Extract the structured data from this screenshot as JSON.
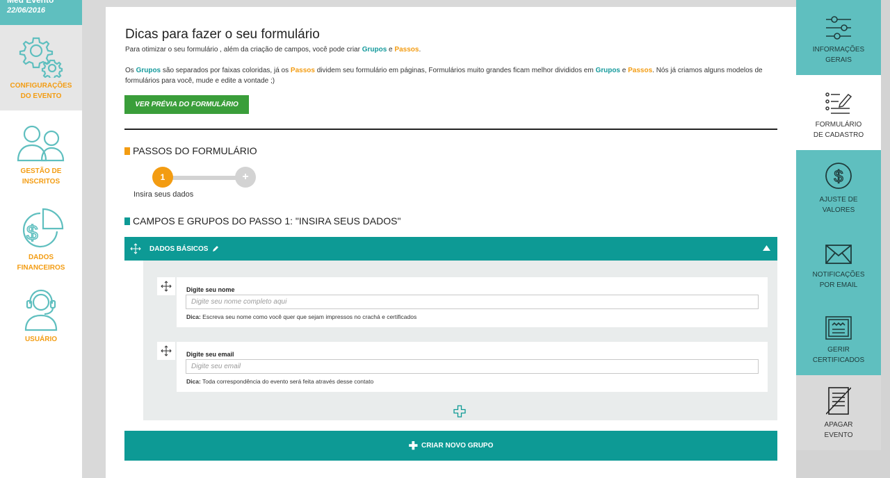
{
  "event": {
    "name": "Meu Evento",
    "date": "22/06/2016"
  },
  "left_nav": [
    {
      "label_lines": [
        "CONFIGURAÇÕES",
        "DO EVENTO"
      ],
      "icon": "gears-icon",
      "active": true
    },
    {
      "label_lines": [
        "GESTÃO DE",
        "INSCRITOS"
      ],
      "icon": "users-icon",
      "active": false
    },
    {
      "label_lines": [
        "DADOS",
        "FINANCEIROS"
      ],
      "icon": "dollar-chart-icon",
      "active": false
    },
    {
      "label_lines": [
        "USUÁRIO"
      ],
      "icon": "headset-user-icon",
      "active": false
    }
  ],
  "tips": {
    "title": "Dicas para fazer o seu formulário",
    "intro_prefix": "Para otimizar o seu formulário , além da criação de campos, você pode criar ",
    "groups_word": "Grupos",
    "and_word": " e ",
    "steps_word": "Passos",
    "intro_suffix": ".",
    "para_1": "Os ",
    "para_2": " são separados por faixas coloridas, já os ",
    "para_3": " dividem seu formulário em páginas, Formulários muito grandes ficam melhor divididos em ",
    "para_4": " e ",
    "para_5": ". Nós já criamos alguns modelos de formulários para você, mude e edite a vontade ;)"
  },
  "preview_button": "VER PRÉVIA DO FORMULÁRIO",
  "steps_section": {
    "title": "PASSOS DO FORMULÁRIO",
    "steps": [
      {
        "number": "1",
        "label": "Insira seus dados"
      }
    ],
    "add_symbol": "+"
  },
  "fields_section": {
    "title": "CAMPOS E GRUPOS DO PASSO 1: \"INSIRA SEUS DADOS\"",
    "group": {
      "title": "DADOS BÁSICOS",
      "fields": [
        {
          "label": "Digite seu nome",
          "placeholder": "Digite seu nome completo aqui",
          "tip_prefix": "Dica:",
          "tip": " Escreva seu nome como você quer que sejam impressos no crachá e certificados"
        },
        {
          "label": "Digite seu email",
          "placeholder": "Digite seu email",
          "tip_prefix": "Dica:",
          "tip": " Toda correspondência do evento será feita através desse contato"
        }
      ]
    }
  },
  "create_group_button": "CRIAR NOVO GRUPO",
  "right_nav": [
    {
      "label_lines": [
        "INFORMAÇÕES",
        "GERAIS"
      ],
      "icon": "sliders-icon",
      "style": "teal"
    },
    {
      "label_lines": [
        "FORMULÁRIO",
        "DE CADASTRO"
      ],
      "icon": "form-edit-icon",
      "style": "white"
    },
    {
      "label_lines": [
        "AJUSTE DE",
        "VALORES"
      ],
      "icon": "dollar-circle-icon",
      "style": "teal"
    },
    {
      "label_lines": [
        "NOTIFICAÇÕES",
        "POR EMAIL"
      ],
      "icon": "envelope-icon",
      "style": "teal"
    },
    {
      "label_lines": [
        "GERIR",
        "CERTIFICADOS"
      ],
      "icon": "certificate-icon",
      "style": "teal"
    },
    {
      "label_lines": [
        "APAGAR",
        "EVENTO"
      ],
      "icon": "delete-document-icon",
      "style": "gray"
    }
  ],
  "colors": {
    "teal": "#0d9a95",
    "light_teal": "#5fbfbf",
    "orange": "#f39c12",
    "green": "#3a9e3a"
  }
}
